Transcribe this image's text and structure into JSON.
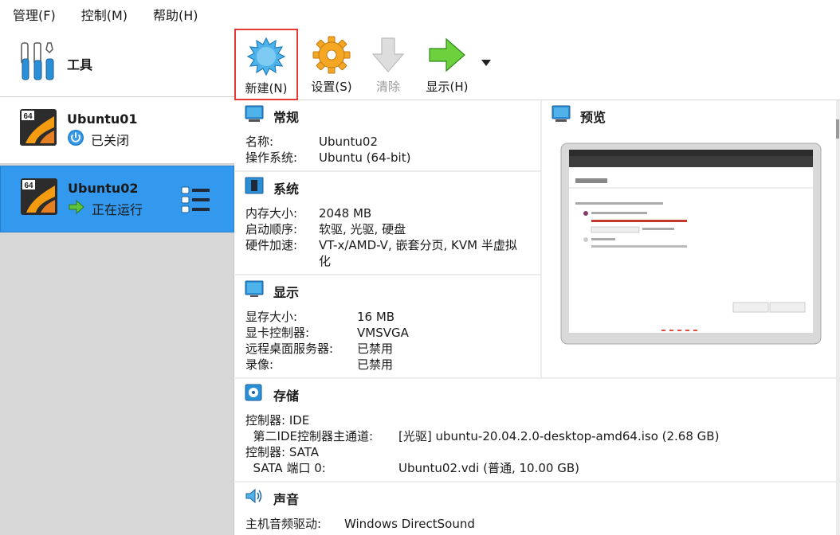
{
  "menu": [
    "管理(F)",
    "控制(M)",
    "帮助(H)"
  ],
  "tools": {
    "label": "工具"
  },
  "vms": [
    {
      "name": "Ubuntu01",
      "status": "已关闭",
      "badge": "64"
    },
    {
      "name": "Ubuntu02",
      "status": "正在运行",
      "badge": "64"
    }
  ],
  "toolbar": {
    "new_label": "新建(N)",
    "settings_label": "设置(S)",
    "discard_label": "清除",
    "show_label": "显示(H)"
  },
  "general": {
    "title": "常规",
    "rows": [
      {
        "k": "名称:",
        "v": "Ubuntu02"
      },
      {
        "k": "操作系统:",
        "v": "Ubuntu (64-bit)"
      }
    ]
  },
  "system": {
    "title": "系统",
    "rows": [
      {
        "k": "内存大小:",
        "v": "2048 MB"
      },
      {
        "k": "启动顺序:",
        "v": "软驱, 光驱, 硬盘"
      },
      {
        "k": "硬件加速:",
        "v": "VT-x/AMD-V, 嵌套分页, KVM 半虚拟"
      },
      {
        "k": "",
        "v": "化"
      }
    ]
  },
  "display": {
    "title": "显示",
    "rows": [
      {
        "k": "显存大小:",
        "v": "16 MB"
      },
      {
        "k": "显卡控制器:",
        "v": "VMSVGA"
      },
      {
        "k": "远程桌面服务器:",
        "v": "已禁用"
      },
      {
        "k": "录像:",
        "v": "已禁用"
      }
    ]
  },
  "preview": {
    "title": "预览"
  },
  "storage": {
    "title": "存储",
    "rows": [
      {
        "k": "控制器: IDE",
        "v": ""
      },
      {
        "k": "  第二IDE控制器主通道:",
        "v": "[光驱] ubuntu-20.04.2.0-desktop-amd64.iso (2.68 GB)"
      },
      {
        "k": "控制器: SATA",
        "v": ""
      },
      {
        "k": "  SATA 端口 0:",
        "v": "Ubuntu02.vdi (普通, 10.00 GB)"
      }
    ]
  },
  "audio": {
    "title": "声音",
    "rows": [
      {
        "k": "主机音频驱动:",
        "v": "Windows DirectSound"
      }
    ]
  },
  "colors": {
    "selected": "#3399ee",
    "highlight": "#e53935",
    "section_bg": "#ffffff",
    "details_bg": "#ececec"
  }
}
